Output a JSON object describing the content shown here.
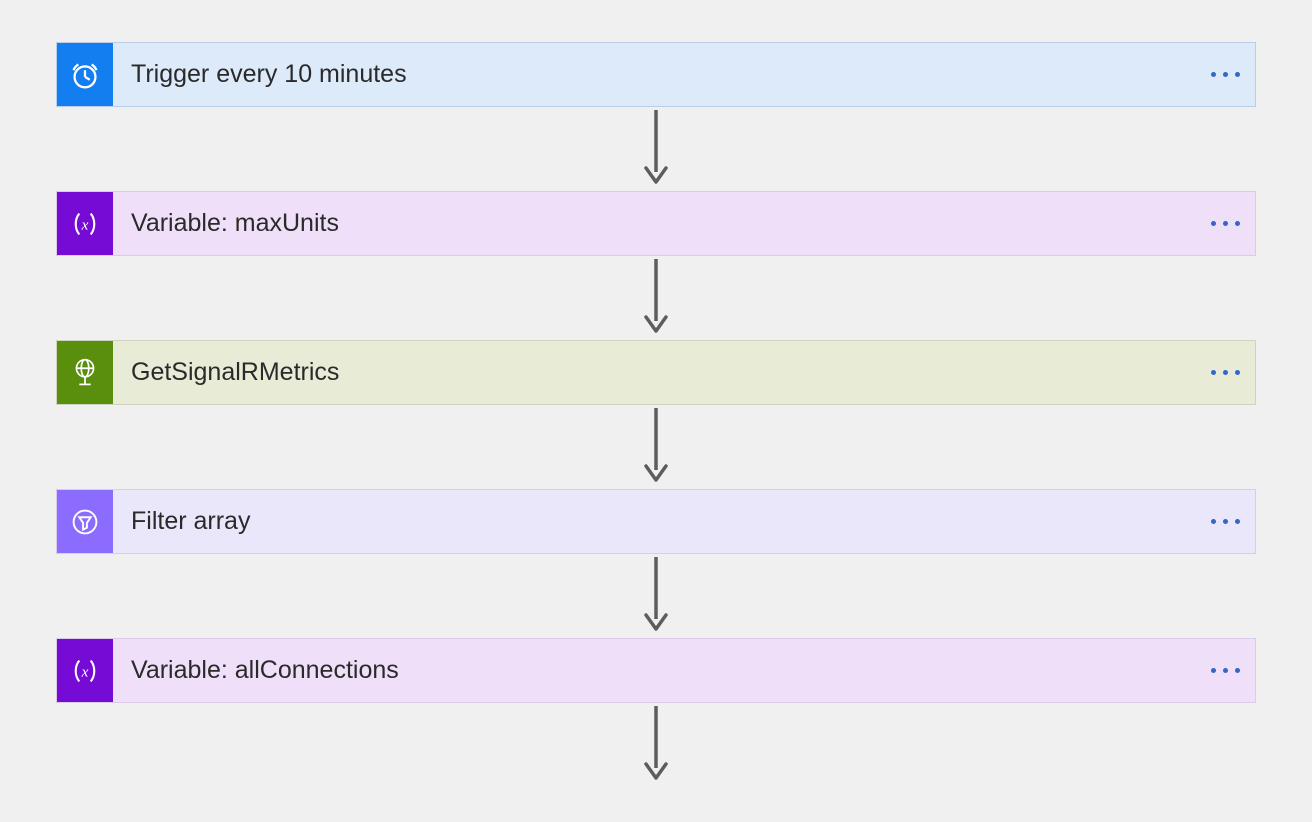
{
  "steps": [
    {
      "kind": "trigger",
      "label": "Trigger every 10 minutes",
      "icon": "clock"
    },
    {
      "kind": "variable",
      "label": "Variable: maxUnits",
      "icon": "variable"
    },
    {
      "kind": "http",
      "label": "GetSignalRMetrics",
      "icon": "globe"
    },
    {
      "kind": "filter",
      "label": "Filter array",
      "icon": "filter"
    },
    {
      "kind": "variable",
      "label": "Variable: allConnections",
      "icon": "variable"
    }
  ]
}
